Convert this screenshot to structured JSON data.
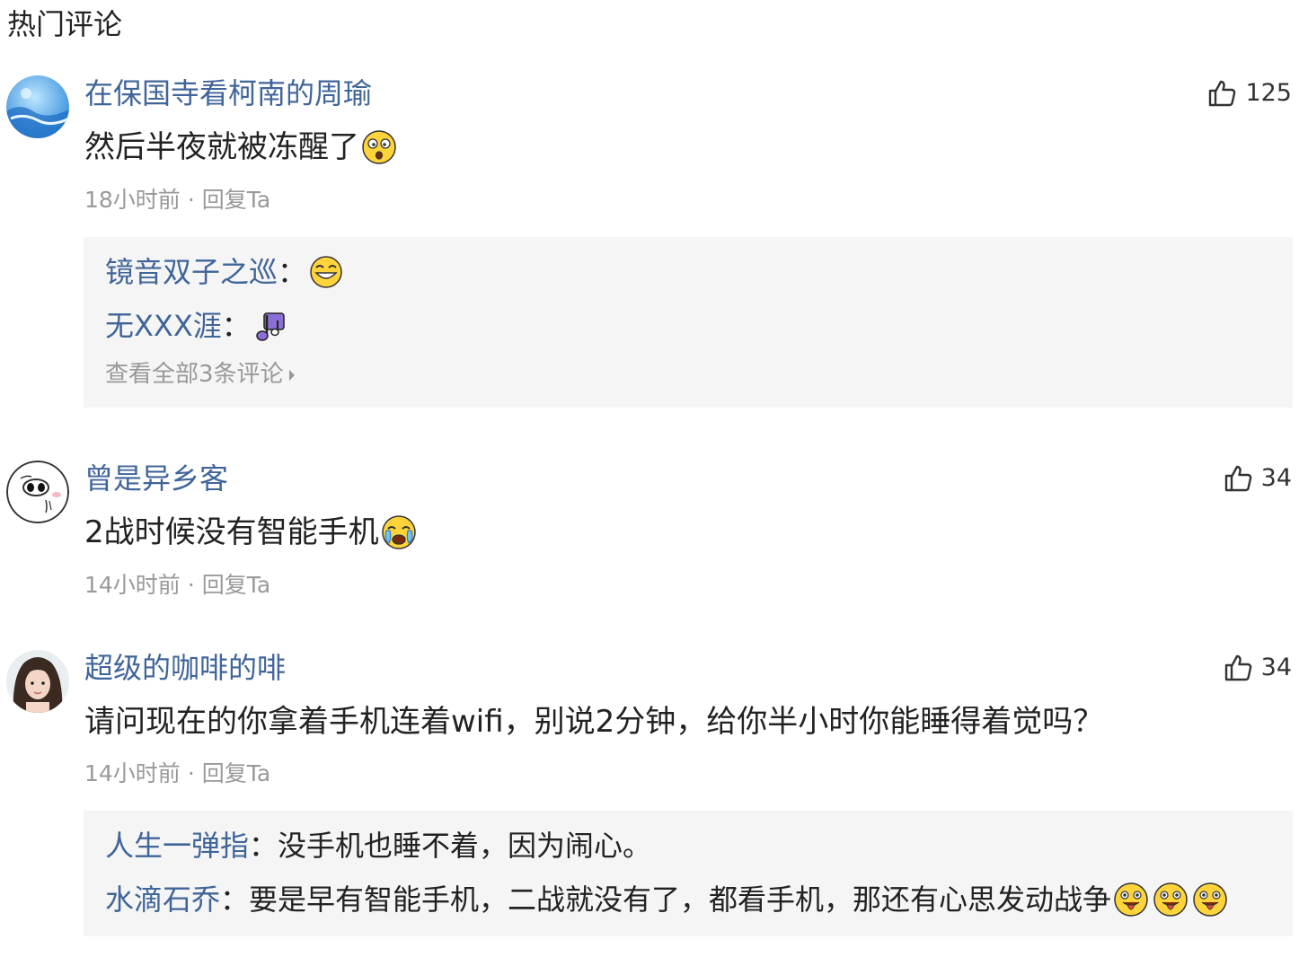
{
  "section": {
    "title": "热门评论"
  },
  "comments": [
    {
      "username": "在保国寺看柯南的周瑜",
      "likes": "125",
      "text": "然后半夜就被冻醒了",
      "time": "18小时前",
      "dot": "·",
      "reply_label": "回复Ta",
      "replies": [
        {
          "user": "镜音双子之巡",
          "sep": "：",
          "text": ""
        },
        {
          "user": "无XXX涯",
          "sep": "：",
          "text": ""
        }
      ],
      "view_all": "查看全部3条评论"
    },
    {
      "username": "曾是异乡客",
      "likes": "34",
      "text": "2战时候没有智能手机",
      "time": "14小时前",
      "dot": "·",
      "reply_label": "回复Ta"
    },
    {
      "username": "超级的咖啡的啡",
      "likes": "34",
      "text": "请问现在的你拿着手机连着wifi，别说2分钟，给你半小时你能睡得着觉吗？",
      "time": "14小时前",
      "dot": "·",
      "reply_label": "回复Ta",
      "replies": [
        {
          "user": "人生一弹指",
          "sep": "：",
          "text": "没手机也睡不着，因为闹心。"
        },
        {
          "user": "水滴石乔",
          "sep": "：",
          "text": "要是早有智能手机，二战就没有了，都看手机，那还有心思发动战争"
        }
      ]
    }
  ],
  "icons": {
    "like": "thumbs-up-icon",
    "emoji_shocked": "shocked-emoji-icon",
    "emoji_happy": "happy-emoji-icon",
    "emoji_music": "music-note-icon",
    "emoji_crying": "crying-emoji-icon",
    "emoji_tongue": "tongue-out-emoji-icon"
  },
  "colors": {
    "username": "#406599",
    "meta": "#999999",
    "reply_bg": "#f5f5f5"
  }
}
